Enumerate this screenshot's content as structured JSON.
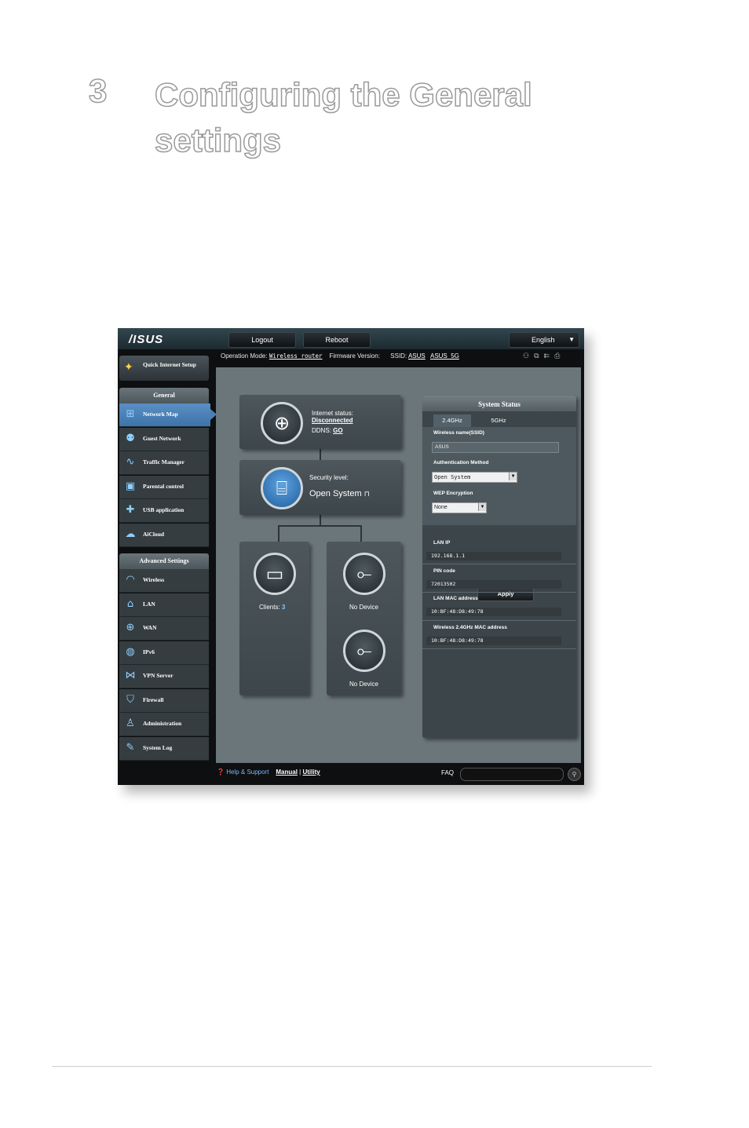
{
  "chapter": {
    "number": "3",
    "title": "Configuring the General settings"
  },
  "router": {
    "logo": "/ISUS",
    "top_buttons": {
      "logout": "Logout",
      "reboot": "Reboot",
      "language": "English"
    },
    "op_bar": {
      "mode_label": "Operation Mode:",
      "mode_value": "Wireless router",
      "firmware_label": "Firmware Version:",
      "ssid_label": "SSID:",
      "ssid_1": "ASUS",
      "ssid_2": "ASUS_5G"
    },
    "sidebar": {
      "quick_setup": "Quick Internet Setup",
      "general_header": "General",
      "general_items": [
        {
          "label": "Network Map",
          "icon": "network-map-icon"
        },
        {
          "label": "Guest Network",
          "icon": "guest-network-icon"
        },
        {
          "label": "Traffic Manager",
          "icon": "traffic-manager-icon"
        },
        {
          "label": "Parental control",
          "icon": "lock-icon"
        },
        {
          "label": "USB application",
          "icon": "puzzle-icon"
        },
        {
          "label": "AiCloud",
          "icon": "cloud-icon"
        }
      ],
      "advanced_header": "Advanced Settings",
      "advanced_items": [
        {
          "label": "Wireless",
          "icon": "wifi-icon"
        },
        {
          "label": "LAN",
          "icon": "home-icon"
        },
        {
          "label": "WAN",
          "icon": "globe-icon"
        },
        {
          "label": "IPv6",
          "icon": "ipv6-icon"
        },
        {
          "label": "VPN Server",
          "icon": "vpn-icon"
        },
        {
          "label": "Firewall",
          "icon": "shield-icon"
        },
        {
          "label": "Administration",
          "icon": "admin-icon"
        },
        {
          "label": "System Log",
          "icon": "log-icon"
        }
      ]
    },
    "network_map": {
      "internet_status_label": "Internet status:",
      "internet_status_value": "Disconnected",
      "ddns_label": "DDNS:",
      "ddns_value": "GO",
      "security_label": "Security level:",
      "security_value": "Open System",
      "clients_label": "Clients:",
      "clients_count": "3",
      "usb1": "No Device",
      "usb2": "No Device"
    },
    "system_status": {
      "title": "System Status",
      "tabs": [
        "2.4GHz",
        "5GHz"
      ],
      "wireless_name_label": "Wireless name(SSID)",
      "wireless_name_value": "ASUS",
      "auth_label": "Authentication Method",
      "auth_value": "Open System",
      "wep_label": "WEP Encryption",
      "wep_value": "None",
      "apply": "Apply",
      "lan_ip_label": "LAN IP",
      "lan_ip_value": "192.168.1.1",
      "pin_label": "PIN code",
      "pin_value": "72013502",
      "lan_mac_label": "LAN MAC address",
      "lan_mac_value": "10:BF:48:D8:49:78",
      "wl_mac_label": "Wireless 2.4GHz MAC address",
      "wl_mac_value": "10:BF:48:D8:49:78"
    },
    "bottom_bar": {
      "help": "Help & Support",
      "manual": "Manual",
      "sep": "|",
      "utility": "Utility",
      "faq": "FAQ"
    }
  }
}
